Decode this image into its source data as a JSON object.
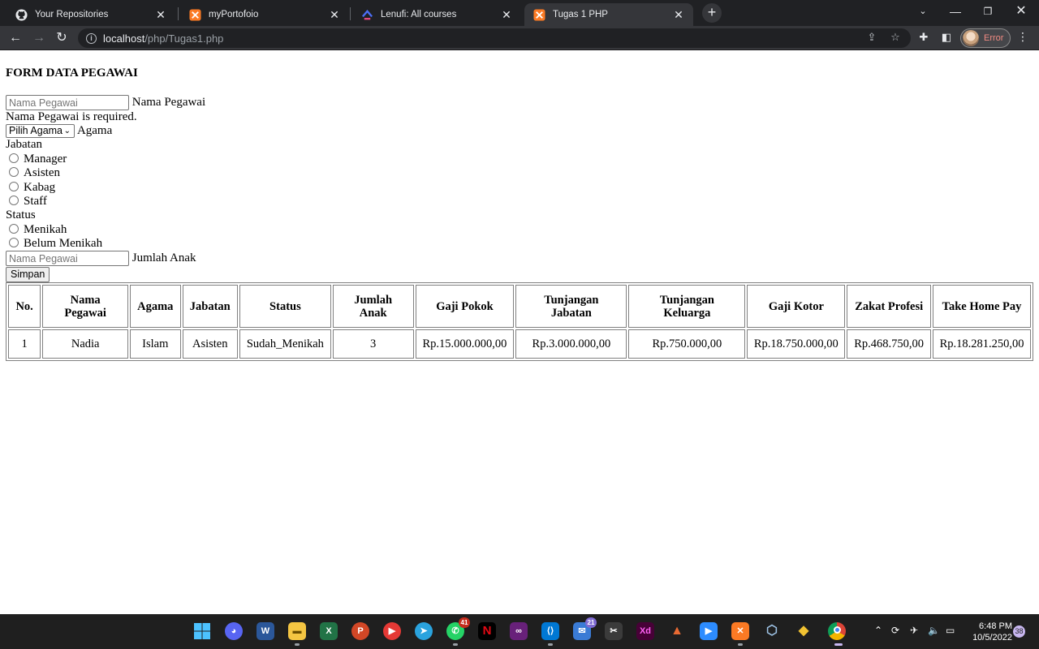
{
  "browser": {
    "tabs": [
      {
        "title": "Your Repositories",
        "icon": "github-icon"
      },
      {
        "title": "myPortofoio",
        "icon": "xampp-icon"
      },
      {
        "title": "Lenufi: All courses",
        "icon": "lenufi-icon"
      },
      {
        "title": "Tugas 1 PHP",
        "icon": "xampp-icon",
        "active": true
      }
    ],
    "url_host": "localhost",
    "url_path": "/php/Tugas1.php",
    "profile_label": "Error"
  },
  "form": {
    "title": "FORM DATA PEGAWAI",
    "nama_placeholder": "Nama Pegawai",
    "nama_label": "Nama Pegawai",
    "nama_error": "Nama Pegawai is required.",
    "agama_selected": "Pilih Agama",
    "agama_label": "Agama",
    "jabatan_label": "Jabatan",
    "jabatan_options": [
      "Manager",
      "Asisten",
      "Kabag",
      "Staff"
    ],
    "status_label": "Status",
    "status_options": [
      "Menikah",
      "Belum Menikah"
    ],
    "anak_placeholder": "Nama Pegawai",
    "anak_label": "Jumlah Anak",
    "submit_label": "Simpan"
  },
  "table": {
    "headers": [
      "No.",
      "Nama Pegawai",
      "Agama",
      "Jabatan",
      "Status",
      "Jumlah Anak",
      "Gaji Pokok",
      "Tunjangan Jabatan",
      "Tunjangan Keluarga",
      "Gaji Kotor",
      "Zakat Profesi",
      "Take Home Pay"
    ],
    "rows": [
      [
        "1",
        "Nadia",
        "Islam",
        "Asisten",
        "Sudah_Menikah",
        "3",
        "Rp.15.000.000,00",
        "Rp.3.000.000,00",
        "Rp.750.000,00",
        "Rp.18.750.000,00",
        "Rp.468.750,00",
        "Rp.18.281.250,00"
      ]
    ]
  },
  "taskbar": {
    "badges": {
      "whatsapp": "41",
      "mail": "21"
    },
    "time": "6:48 PM",
    "date": "10/5/2022",
    "notifications": "38"
  }
}
